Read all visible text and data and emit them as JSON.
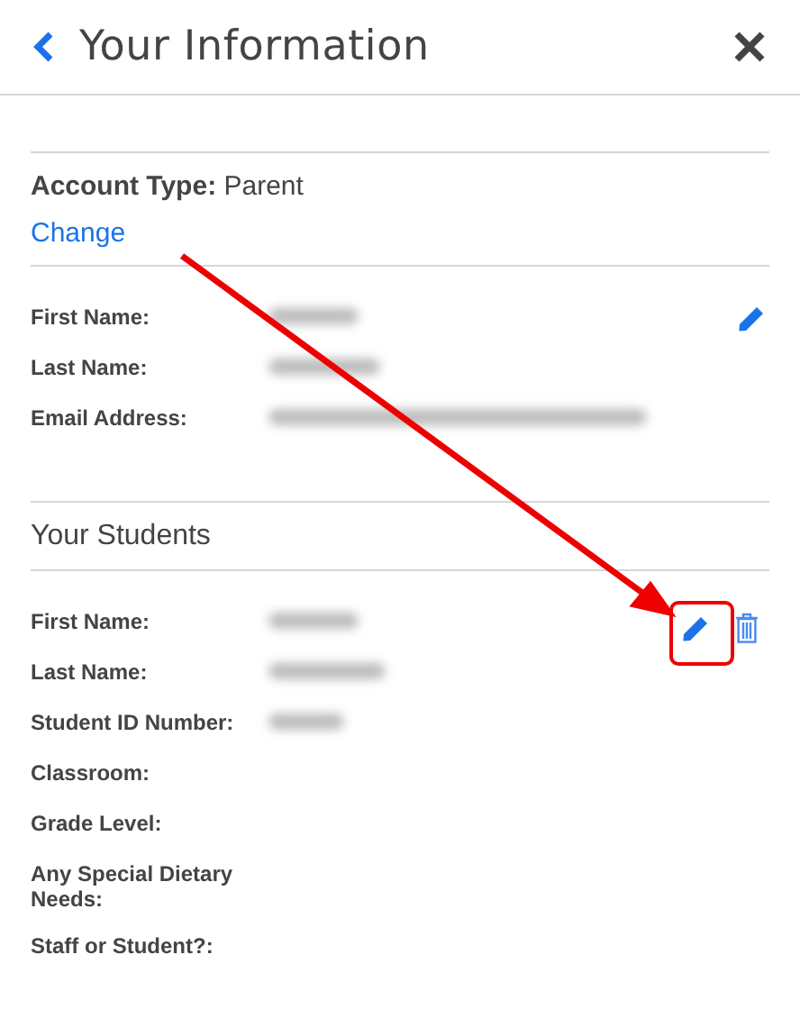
{
  "header": {
    "title": "Your Information"
  },
  "account": {
    "label": "Account Type:",
    "value": "Parent",
    "change_link": "Change"
  },
  "parent_fields": [
    {
      "label": "First Name:",
      "blurred": true
    },
    {
      "label": "Last Name:",
      "blurred": true
    },
    {
      "label": "Email Address:",
      "blurred": true
    }
  ],
  "students_heading": "Your Students",
  "student_fields": [
    {
      "label": "First Name:",
      "blurred": true
    },
    {
      "label": "Last Name:",
      "blurred": true
    },
    {
      "label": "Student ID Number:",
      "blurred": true
    },
    {
      "label": "Classroom:",
      "blurred": false
    },
    {
      "label": "Grade Level:",
      "blurred": false
    },
    {
      "label": "Any Special Dietary Needs:",
      "blurred": false
    },
    {
      "label": "Staff or Student?:",
      "blurred": false
    }
  ]
}
